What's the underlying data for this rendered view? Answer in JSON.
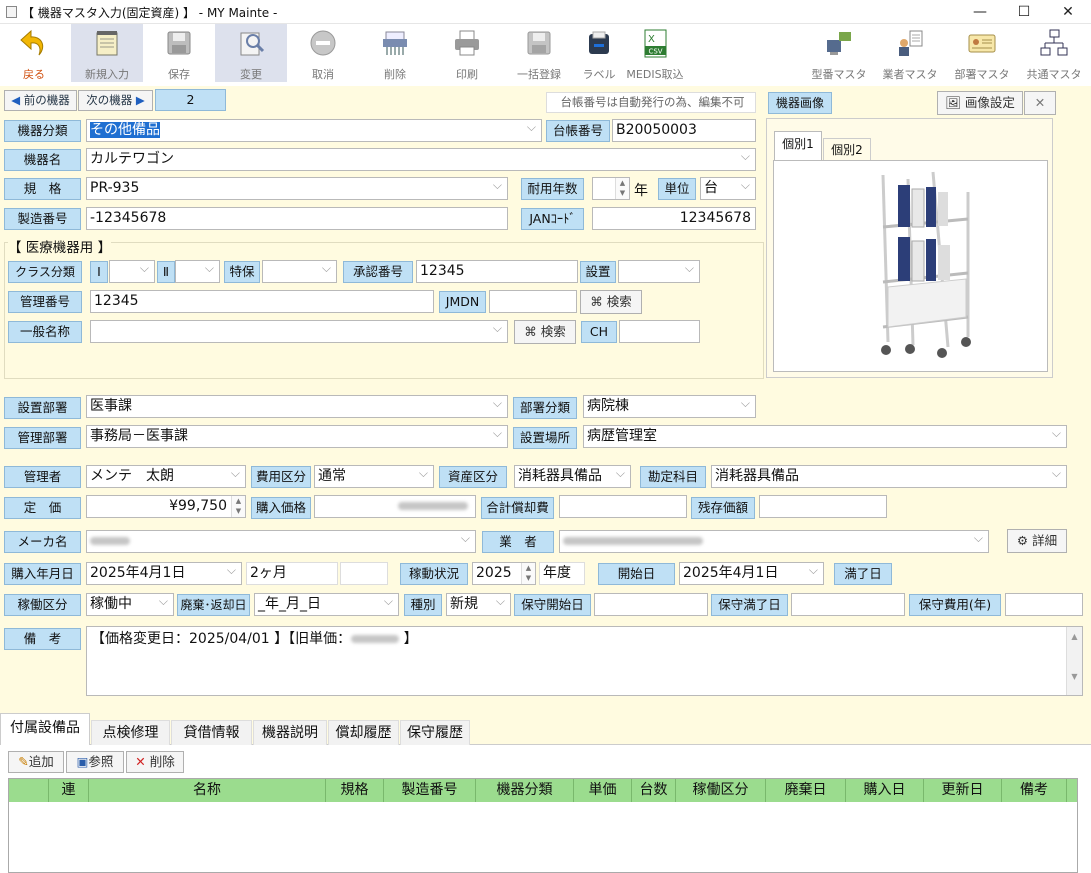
{
  "window": {
    "title": "【 機器マスタ入力(固定資産) 】 - MY Mainte -",
    "minimize": "—",
    "maximize": "☐",
    "close": "✕"
  },
  "toolbar": {
    "back": "戻る",
    "new": "新規入力",
    "save": "保存",
    "edit": "変更",
    "cancel": "取消",
    "delete": "削除",
    "print": "印刷",
    "bulk": "一括登録",
    "label": "ラベル",
    "medis": "MEDIS取込",
    "medis_icon": "CSV",
    "model_master": "型番マスタ",
    "vendor_master": "業者マスタ",
    "dept_master": "部署マスタ",
    "common_master": "共通マスタ"
  },
  "nav": {
    "prev": "前の機器",
    "next": "次の機器",
    "index": "2",
    "notice": "台帳番号は自動発行の為、編集不可"
  },
  "image_panel": {
    "title": "機器画像",
    "settings": "画像設定",
    "tab1": "個別1",
    "tab2": "個別2"
  },
  "basic": {
    "category_label": "機器分類",
    "category": "その他備品",
    "ledger_label": "台帳番号",
    "ledger": "B20050003",
    "name_label": "機器名",
    "name": "カルテワゴン",
    "spec_label": "規　格",
    "spec": "PR-935",
    "life_label": "耐用年数",
    "life_unit": "年",
    "unit_label": "単位",
    "unit": "台",
    "serial_label": "製造番号",
    "serial": "-12345678",
    "jan_label": "JANｺｰﾄﾞ",
    "jan": "12345678"
  },
  "medical": {
    "section": "【 医療機器用 】",
    "class_label": "クラス分類",
    "roman1": "Ⅰ",
    "roman2": "Ⅱ",
    "special": "特保",
    "approval_label": "承認番号",
    "approval": "12345",
    "install_label": "設置",
    "mgmt_label": "管理番号",
    "mgmt": "12345",
    "jmdn_label": "JMDN",
    "search": "検索",
    "generic_label": "一般名称",
    "ch_label": "CH"
  },
  "dept": {
    "install_dept_label": "設置部署",
    "install_dept": "医事課",
    "dept_cat_label": "部署分類",
    "dept_cat": "病院棟",
    "mgmt_dept_label": "管理部署",
    "mgmt_dept": "事務局－医事課",
    "location_label": "設置場所",
    "location": "病歴管理室"
  },
  "finance": {
    "manager_label": "管理者",
    "manager": "メンテ　太朗",
    "cost_label": "費用区分",
    "cost": "通常",
    "asset_label": "資産区分",
    "asset": "消耗器具備品",
    "account_label": "勘定科目",
    "account": "消耗器具備品",
    "price_label": "定　価",
    "price": "¥99,750",
    "purchase_label": "購入価格",
    "depr_label": "合計償却費",
    "residual_label": "残存価額",
    "maker_label": "メーカ名",
    "vendor_label": "業　者",
    "detail": "詳細"
  },
  "status": {
    "buy_date_label": "購入年月日",
    "buy_date": "2025年4月1日",
    "period": "2ヶ月",
    "op_status_label": "稼動状況",
    "fy": "2025",
    "fy_unit": "年度",
    "start_label": "開始日",
    "start": "2025年4月1日",
    "end_label": "満了日",
    "op_label": "稼働区分",
    "op": "稼働中",
    "disposal_label": "廃棄･返却日",
    "disposal": "_年_月_日",
    "kind_label": "種別",
    "kind": "新規",
    "maint_start_label": "保守開始日",
    "maint_end_label": "保守満了日",
    "maint_cost_label": "保守費用(年)"
  },
  "remarks": {
    "label": "備　考",
    "value_a": "【価格変更日：2025/04/01 】【旧単価：",
    "value_b": " 】"
  },
  "tabs": [
    "付属設備品",
    "点検修理",
    "貸借情報",
    "機器説明",
    "償却履歴",
    "保守履歴"
  ],
  "subtoolbar": {
    "add": "追加",
    "ref": "参照",
    "del": "削除"
  },
  "grid": {
    "columns": [
      "",
      "連",
      "名称",
      "規格",
      "製造番号",
      "機器分類",
      "単価",
      "台数",
      "稼働区分",
      "廃棄日",
      "購入日",
      "更新日",
      "備考"
    ]
  }
}
